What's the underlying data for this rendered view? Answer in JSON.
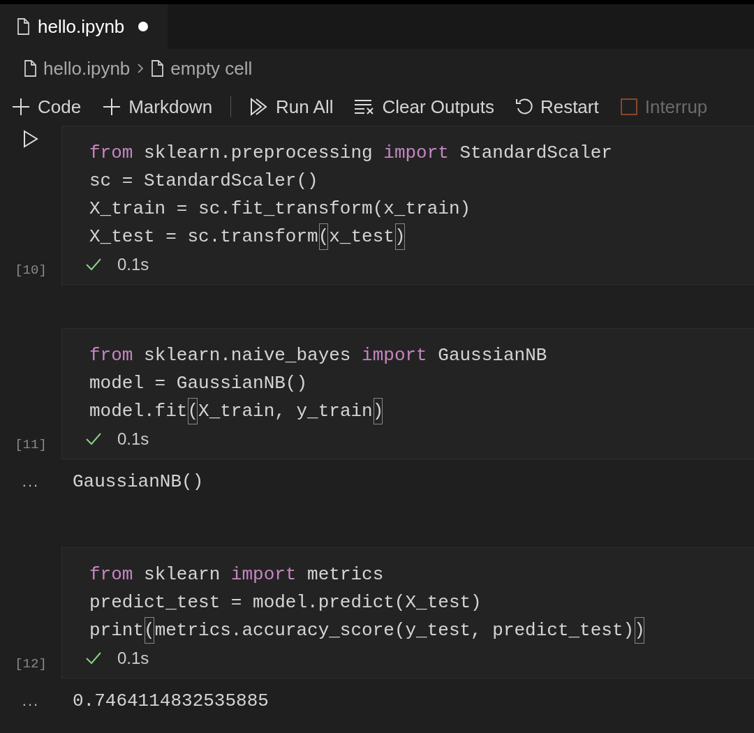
{
  "tab": {
    "title": "hello.ipynb",
    "modified": true
  },
  "breadcrumb": [
    "hello.ipynb",
    "empty cell"
  ],
  "toolbar": [
    {
      "kind": "add",
      "label": "Code",
      "disabled": false
    },
    {
      "kind": "add",
      "label": "Markdown",
      "disabled": false
    },
    {
      "kind": "separator"
    },
    {
      "kind": "run",
      "label": "Run All",
      "disabled": false
    },
    {
      "kind": "clear",
      "label": "Clear Outputs",
      "disabled": false
    },
    {
      "kind": "restart",
      "label": "Restart",
      "disabled": false
    },
    {
      "kind": "interrupt",
      "label": "Interrup",
      "disabled": true
    }
  ],
  "cells": [
    {
      "hovered": true,
      "count": "[10]",
      "succeeded": true,
      "duration": "0.1s",
      "lines": [
        [
          {
            "kind": "keyword",
            "text": "from"
          },
          {
            "kind": "plain",
            "text": " sklearn.preprocessing "
          },
          {
            "kind": "keyword",
            "text": "import"
          },
          {
            "kind": "plain",
            "text": " StandardScaler"
          }
        ],
        [
          {
            "kind": "plain",
            "text": "sc = StandardScaler()"
          }
        ],
        [
          {
            "kind": "plain",
            "text": "X_train = sc.fit_transform(x_train)"
          }
        ],
        [
          {
            "kind": "plain",
            "text": "X_test = sc.transform"
          },
          {
            "kind": "bracket",
            "text": "("
          },
          {
            "kind": "plain",
            "text": "x_test"
          },
          {
            "kind": "bracket",
            "text": ")"
          }
        ]
      ]
    },
    {
      "hovered": false,
      "count": "[11]",
      "succeeded": true,
      "duration": "0.1s",
      "lines": [
        [
          {
            "kind": "keyword",
            "text": "from"
          },
          {
            "kind": "plain",
            "text": " sklearn.naive_bayes "
          },
          {
            "kind": "keyword",
            "text": "import"
          },
          {
            "kind": "plain",
            "text": " GaussianNB"
          }
        ],
        [
          {
            "kind": "plain",
            "text": "model = GaussianNB()"
          }
        ],
        [
          {
            "kind": "plain",
            "text": "model.fit"
          },
          {
            "kind": "bracket",
            "text": "("
          },
          {
            "kind": "plain",
            "text": "X_train, y_train"
          },
          {
            "kind": "bracket",
            "text": ")"
          }
        ]
      ],
      "output": {
        "marker": "...",
        "text": "GaussianNB()"
      }
    },
    {
      "hovered": false,
      "count": "[12]",
      "succeeded": true,
      "duration": "0.1s",
      "lines": [
        [
          {
            "kind": "keyword",
            "text": "from"
          },
          {
            "kind": "plain",
            "text": " sklearn "
          },
          {
            "kind": "keyword",
            "text": "import"
          },
          {
            "kind": "plain",
            "text": " metrics"
          }
        ],
        [
          {
            "kind": "plain",
            "text": "predict_test = model.predict(X_test)"
          }
        ],
        [
          {
            "kind": "plain",
            "text": "print"
          },
          {
            "kind": "bracket",
            "text": "("
          },
          {
            "kind": "plain",
            "text": "metrics.accuracy_score(y_test, predict_test)"
          },
          {
            "kind": "bracket",
            "text": ")"
          }
        ]
      ],
      "output": {
        "marker": "...",
        "text": "0.7464114832535885"
      }
    }
  ]
}
